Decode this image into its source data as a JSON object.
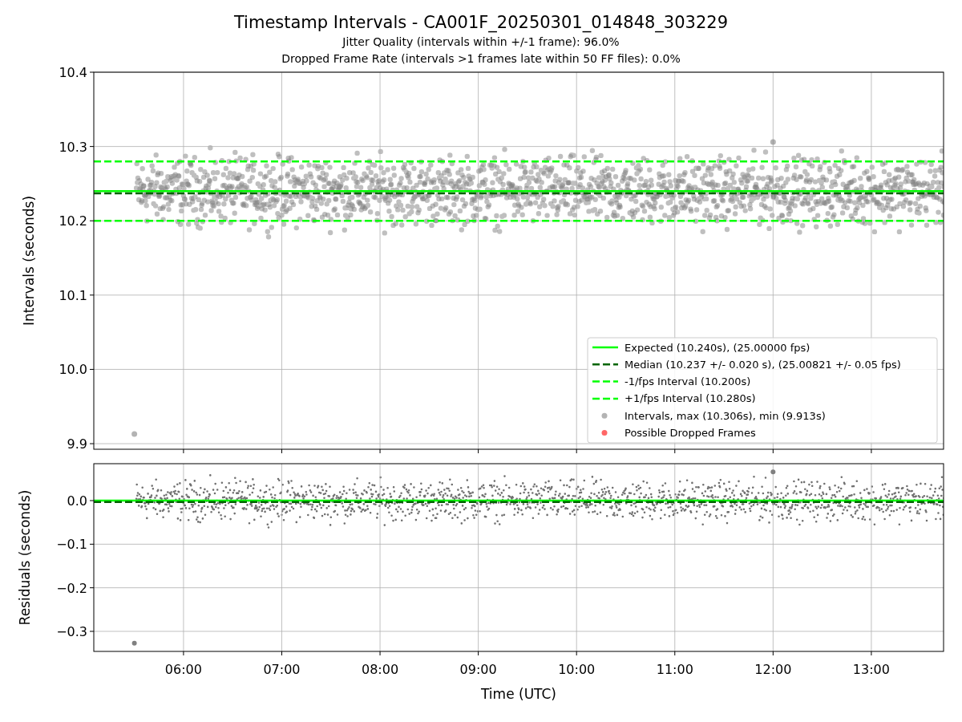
{
  "figure": {
    "title": "Timestamp Intervals - CA001F_20250301_014848_303229",
    "subtitles": [
      "Jitter Quality (intervals within +/-1 frame): 96.0%",
      "Dropped Frame Rate (intervals >1 frames late within 50 FF files): 0.0%"
    ]
  },
  "panels": [
    {
      "chart_data": {
        "type": "scatter",
        "ylabel": "Intervals (seconds)",
        "grid": true,
        "x": [
          5.087,
          5.5,
          12.0,
          13.735
        ],
        "xlim": [
          5.087,
          13.735
        ],
        "ylim": [
          9.8925,
          10.4
        ],
        "yticks": [
          {
            "value": 9.9,
            "label": "9.9"
          },
          {
            "value": 10.0,
            "label": "10.0"
          },
          {
            "value": 10.1,
            "label": "10.1"
          },
          {
            "value": 10.2,
            "label": "10.2"
          },
          {
            "value": 10.3,
            "label": "10.3"
          },
          {
            "value": 10.4,
            "label": "10.4"
          }
        ],
        "series": [
          {
            "name": "Expected (10.240s), (25.00000 fps)",
            "type": "line",
            "line_style": "solid",
            "color": "#00ff00",
            "values": [
              10.24,
              10.24,
              10.24,
              10.24
            ]
          },
          {
            "name": "Median (10.237 +/- 0.020 s), (25.00821 +/- 0.05 fps)",
            "type": "line",
            "line_style": "dashed",
            "color": "#006400",
            "values": [
              10.237,
              10.237,
              10.237,
              10.237
            ]
          },
          {
            "name": "-1/fps Interval (10.200s)",
            "type": "line",
            "line_style": "dashed",
            "color": "#00ff00",
            "values": [
              10.2,
              10.2,
              10.2,
              10.2
            ]
          },
          {
            "name": "+1/fps Interval (10.280s)",
            "type": "line",
            "line_style": "dashed",
            "color": "#00ff00",
            "values": [
              10.28,
              10.28,
              10.28,
              10.28
            ]
          },
          {
            "name": "Intervals, max (10.306s), min (9.913s)",
            "type": "scatter",
            "color": "#808080",
            "values": [
              null,
              9.913,
              10.306,
              null
            ]
          },
          {
            "name": "Possible Dropped Frames",
            "type": "scatter",
            "color": "#ff0000",
            "values": [
              null,
              null,
              null,
              null
            ]
          }
        ],
        "legend": "lower right"
      }
    },
    {
      "chart_data": {
        "type": "scatter",
        "xlabel": "Time (UTC)",
        "ylabel": "Residuals (seconds)",
        "grid": true,
        "x": [
          5.087,
          5.5,
          12.0,
          13.735
        ],
        "xlim": [
          5.087,
          13.735
        ],
        "ylim": [
          -0.346,
          0.0847
        ],
        "xticks": [
          {
            "value": 6,
            "label": "06:00"
          },
          {
            "value": 7,
            "label": "07:00"
          },
          {
            "value": 8,
            "label": "08:00"
          },
          {
            "value": 9,
            "label": "09:00"
          },
          {
            "value": 10,
            "label": "10:00"
          },
          {
            "value": 11,
            "label": "11:00"
          },
          {
            "value": 12,
            "label": "12:00"
          },
          {
            "value": 13,
            "label": "13:00"
          }
        ],
        "yticks": [
          {
            "value": -0.3,
            "label": "−0.3"
          },
          {
            "value": -0.2,
            "label": "−0.2"
          },
          {
            "value": -0.1,
            "label": "−0.1"
          },
          {
            "value": 0.0,
            "label": "0.0"
          }
        ],
        "series": [
          {
            "type": "line",
            "line_style": "solid",
            "color": "#00ff00",
            "values": [
              0.0,
              0.0,
              0.0,
              0.0
            ]
          },
          {
            "type": "line",
            "line_style": "dashed",
            "color": "#006400",
            "values": [
              -0.003,
              -0.003,
              -0.003,
              -0.003
            ]
          },
          {
            "type": "scatter",
            "color": "#808080",
            "values": [
              null,
              -0.327,
              0.066,
              null
            ]
          }
        ]
      }
    }
  ]
}
